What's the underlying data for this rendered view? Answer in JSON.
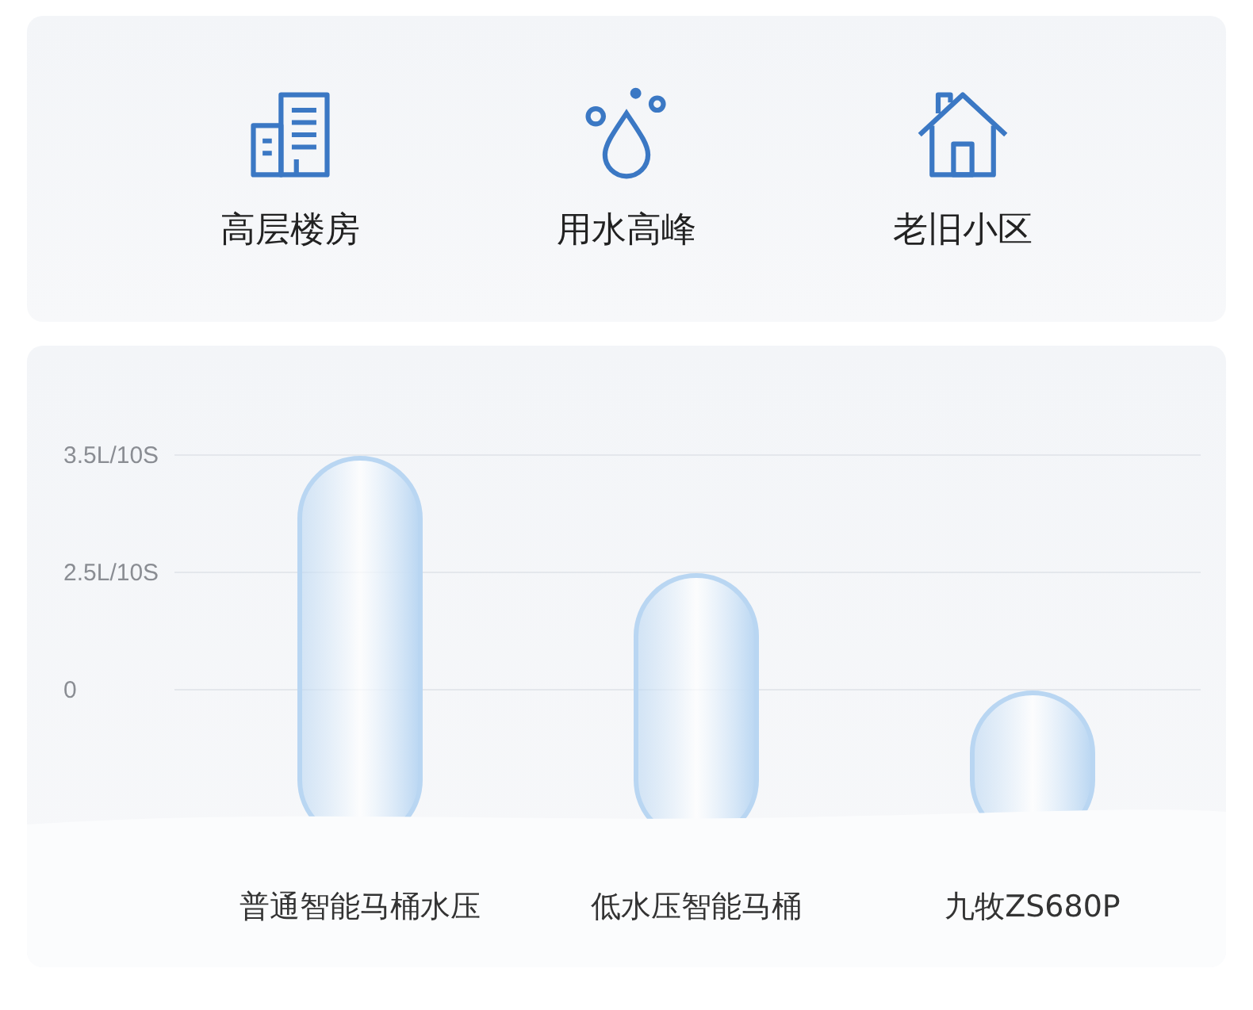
{
  "features": [
    {
      "kind": "building",
      "label": "高层楼房"
    },
    {
      "kind": "drop",
      "label": "用水高峰"
    },
    {
      "kind": "house",
      "label": "老旧小区"
    }
  ],
  "comparison": {
    "y_axis_labels": [
      "3.5L/10S",
      "2.5L/10S",
      "0"
    ],
    "bars": [
      {
        "label": "普通智能马桶水压"
      },
      {
        "label": "低水压智能马桶"
      },
      {
        "label": "九牧ZS680P"
      }
    ]
  }
}
